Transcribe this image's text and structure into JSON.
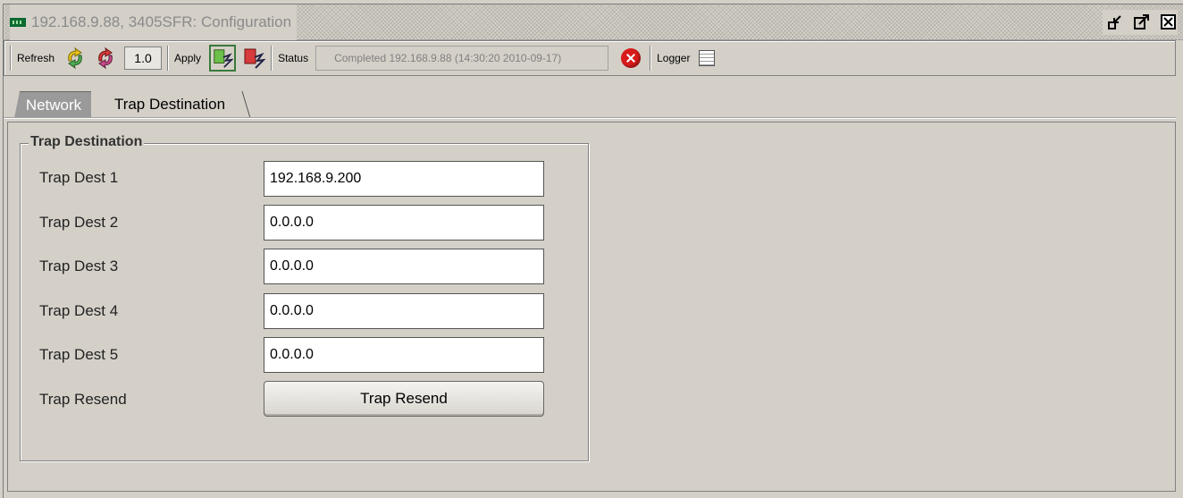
{
  "window": {
    "title": "192.168.9.88, 3405SFR: Configuration",
    "buttons": [
      "minimize-icon",
      "maximize-icon",
      "close-icon"
    ]
  },
  "toolbar": {
    "refresh_label": "Refresh",
    "version": "1.0",
    "apply_label": "Apply",
    "status_label": "Status",
    "status_text": "Completed 192.168.9.88 (14:30:20  2010-09-17)",
    "logger_label": "Logger"
  },
  "tabs": [
    {
      "label": "Network",
      "active": false
    },
    {
      "label": "Trap Destination",
      "active": true
    }
  ],
  "group": {
    "title": "Trap Destination",
    "rows": [
      {
        "label": "Trap Dest 1",
        "value": "192.168.9.200"
      },
      {
        "label": "Trap Dest 2",
        "value": "0.0.0.0"
      },
      {
        "label": "Trap Dest 3",
        "value": "0.0.0.0"
      },
      {
        "label": "Trap Dest 4",
        "value": "0.0.0.0"
      },
      {
        "label": "Trap Dest 5",
        "value": "0.0.0.0"
      }
    ],
    "resend_label": "Trap Resend",
    "resend_button": "Trap Resend"
  }
}
